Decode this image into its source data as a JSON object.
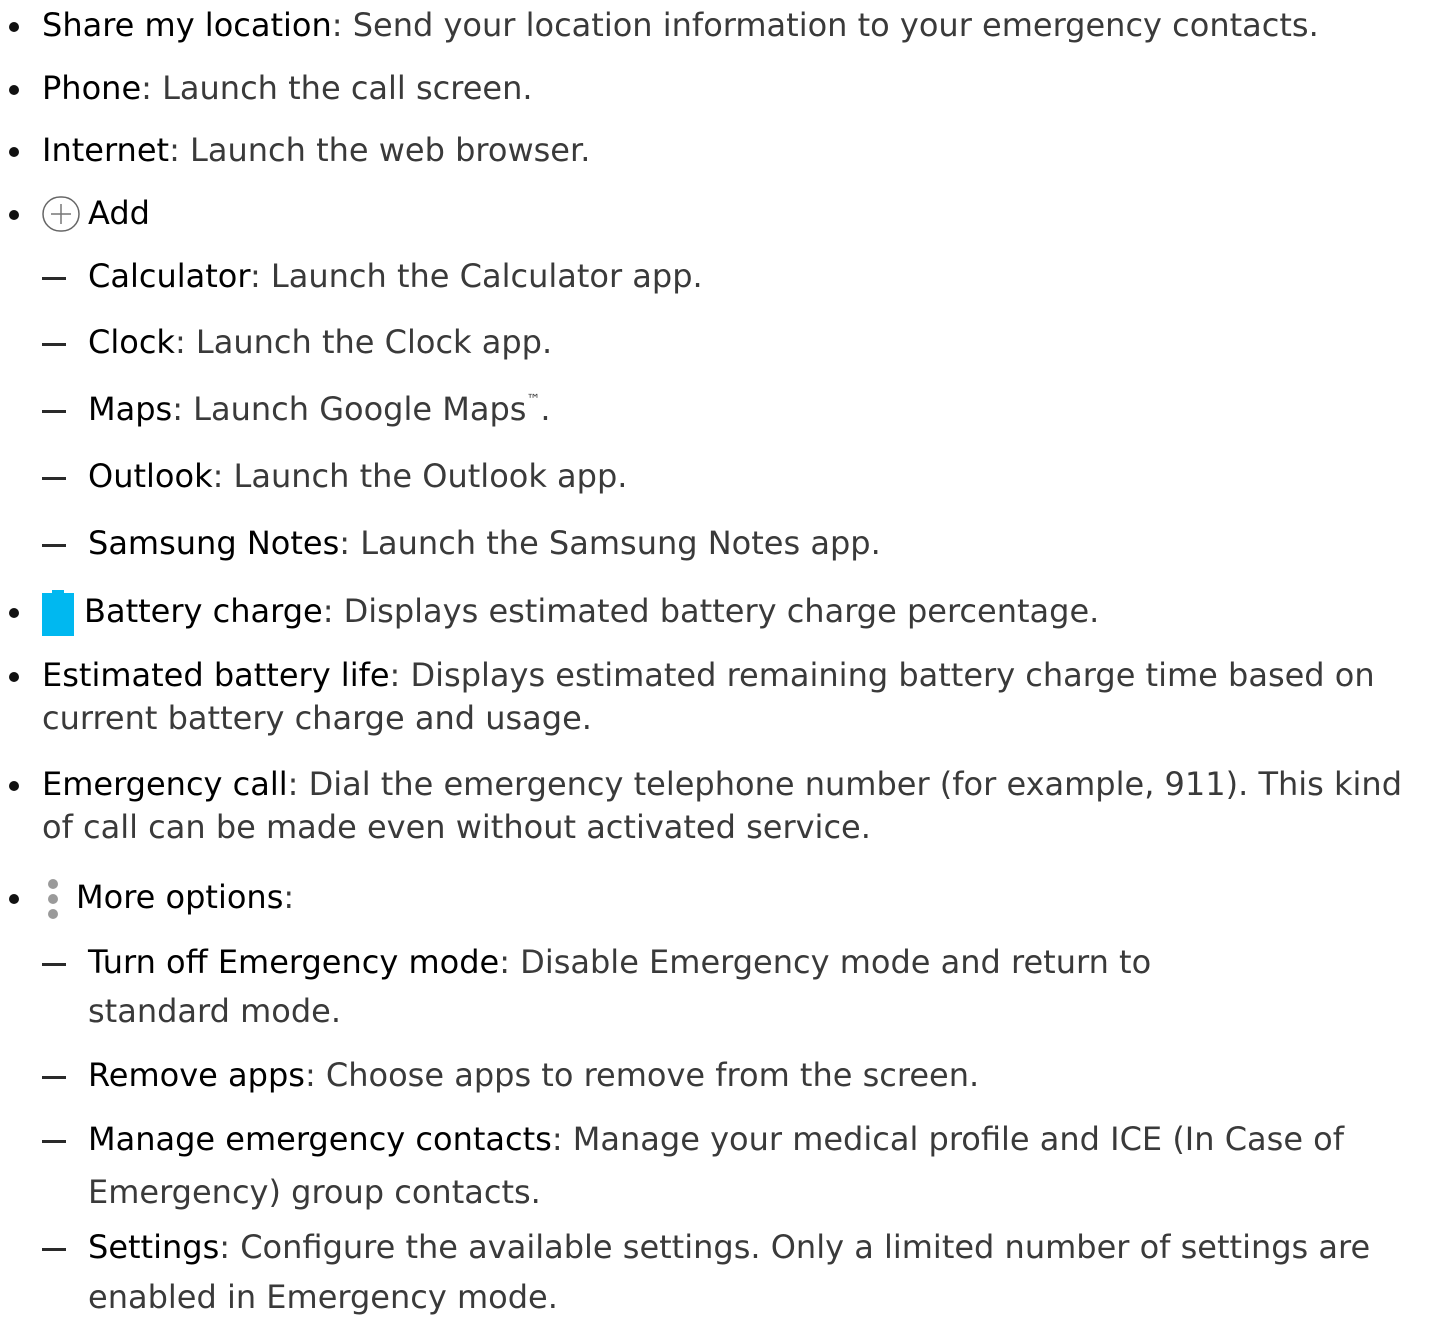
{
  "items": [
    {
      "term": "Share my location",
      "desc": ": Send your location information to your emergency contacts."
    },
    {
      "term": "Phone",
      "desc": ": Launch the call screen."
    },
    {
      "term": "Internet",
      "desc": ": Launch the web browser."
    },
    {
      "term": "Add",
      "desc": "",
      "icon": "plus-circle-icon"
    },
    {
      "term": "Calculator",
      "desc": ": Launch the Calculator app."
    },
    {
      "term": "Clock",
      "desc": ": Launch the Clock app."
    },
    {
      "term": "Maps",
      "desc": ": Launch Google Maps",
      "sup": "™",
      "tail": "."
    },
    {
      "term": "Outlook",
      "desc": ": Launch the Outlook app."
    },
    {
      "term": "Samsung Notes",
      "desc": ": Launch the Samsung Notes app."
    },
    {
      "term": "Battery charge",
      "desc": ": Displays estimated battery charge percentage.",
      "icon": "battery-icon",
      "icon_color": "#00b8f0"
    },
    {
      "term": "Estimated battery life",
      "desc": ": Displays estimated remaining battery charge time based on",
      "cont": "current battery charge and usage."
    },
    {
      "term": "Emergency call",
      "desc": ": Dial the emergency telephone number (for example, 911). This kind",
      "cont": "of call can be made even without activated service."
    },
    {
      "term": "More options",
      "desc": ":",
      "icon": "more-options-icon"
    },
    {
      "term": "Turn off Emergency mode",
      "desc": ": Disable Emergency mode and return to",
      "cont": "standard mode."
    },
    {
      "term": "Remove apps",
      "desc": ": Choose apps to remove from the screen."
    },
    {
      "term": "Manage emergency contacts",
      "desc": ": Manage your medical profile and ICE (In Case of",
      "cont": "Emergency) group contacts."
    },
    {
      "term": "Settings",
      "desc": ": Configure the available settings. Only a limited number of settings are",
      "cont": "enabled in Emergency mode."
    }
  ]
}
